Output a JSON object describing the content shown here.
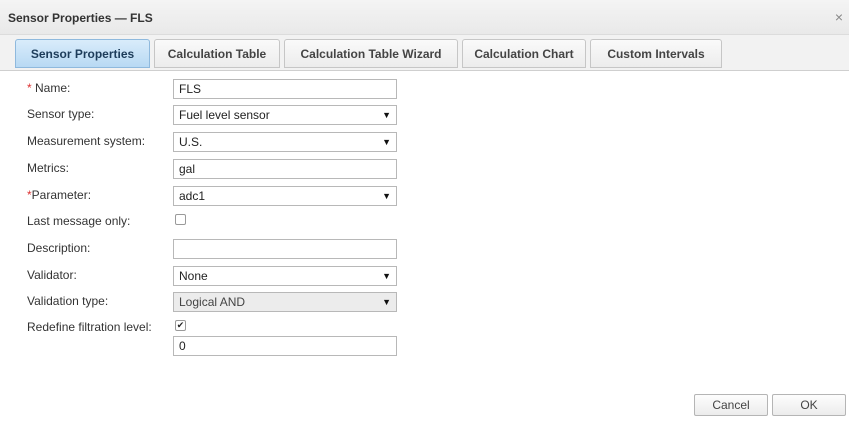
{
  "dialog": {
    "title": "Sensor Properties — FLS",
    "close_glyph": "×"
  },
  "tabs": [
    {
      "label": "Sensor Properties",
      "active": true
    },
    {
      "label": "Calculation Table"
    },
    {
      "label": "Calculation Table Wizard"
    },
    {
      "label": "Calculation Chart"
    },
    {
      "label": "Custom Intervals"
    }
  ],
  "form": {
    "name": {
      "label": "Name:",
      "required_mark": "*",
      "value": "FLS"
    },
    "sensor_type": {
      "label": "Sensor type:",
      "value": "Fuel level sensor"
    },
    "measurement_system": {
      "label": "Measurement system:",
      "value": "U.S."
    },
    "metrics": {
      "label": "Metrics:",
      "value": "gal"
    },
    "parameter": {
      "label": "Parameter:",
      "required_mark": "*",
      "value": "adc1"
    },
    "last_message_only": {
      "label": "Last message only:",
      "checked": false
    },
    "description": {
      "label": "Description:",
      "value": ""
    },
    "validator": {
      "label": "Validator:",
      "value": "None"
    },
    "validation_type": {
      "label": "Validation type:",
      "value": "Logical AND"
    },
    "redefine_filtration": {
      "label": "Redefine filtration level:",
      "checked": true,
      "check_glyph": "✔",
      "value": "0"
    }
  },
  "dropdown_arrow": "▼",
  "buttons": {
    "cancel": "Cancel",
    "ok": "OK"
  },
  "colors": {
    "active_tab": "#b8d9f3",
    "required": "#dd3333"
  }
}
